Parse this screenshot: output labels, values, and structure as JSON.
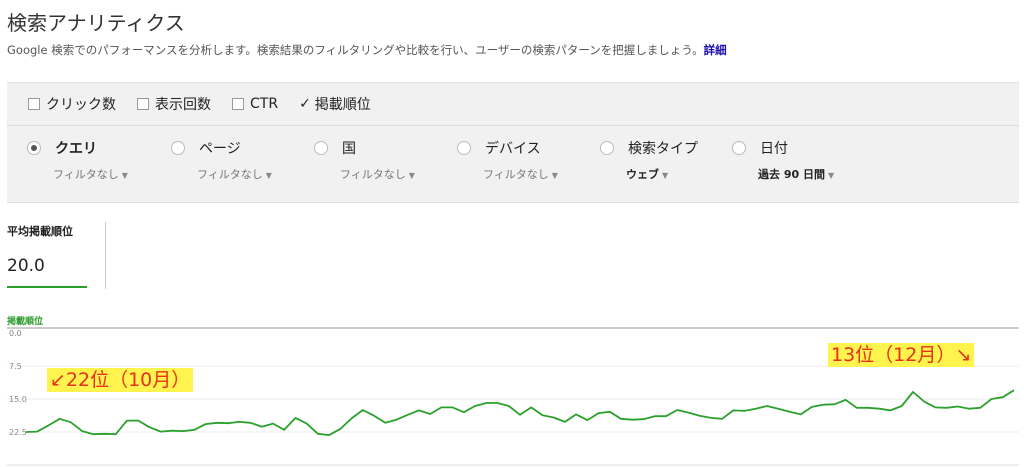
{
  "header": {
    "title": "検索アナリティクス",
    "description": "Google 検索でのパフォーマンスを分析します。検索結果のフィルタリングや比較を行い、ユーザーの検索パターンを把握しましょう。",
    "details_link": "詳細"
  },
  "metrics": [
    {
      "label": "クリック数",
      "checked": false
    },
    {
      "label": "表示回数",
      "checked": false
    },
    {
      "label": "CTR",
      "checked": false
    },
    {
      "label": "掲載順位",
      "checked": true,
      "mark": "✓"
    }
  ],
  "dimensions": [
    {
      "label": "クエリ",
      "selected": true,
      "filter": "フィルタなし"
    },
    {
      "label": "ページ",
      "selected": false,
      "filter": "フィルタなし"
    },
    {
      "label": "国",
      "selected": false,
      "filter": "フィルタなし"
    },
    {
      "label": "デバイス",
      "selected": false,
      "filter": "フィルタなし"
    },
    {
      "label": "検索タイプ",
      "selected": false,
      "filter": "ウェブ"
    },
    {
      "label": "日付",
      "selected": false,
      "filter": "過去 90 日間"
    }
  ],
  "summary": {
    "label": "平均掲載順位",
    "value": "20.0"
  },
  "annotations": {
    "start": "↙22位（10月）",
    "end": "13位（12月）↘"
  },
  "colors": {
    "series": "#2ca02c",
    "annotation_bg": "#fff34d",
    "annotation_text": "#e8311a"
  },
  "chart_data": {
    "type": "line",
    "title": "",
    "legend": "掲載順位",
    "y_ticks": [
      "0.0",
      "7.5",
      "15.0",
      "22.5"
    ],
    "ylim": [
      0,
      25
    ],
    "y_inverted": true,
    "series": [
      {
        "name": "掲載順位",
        "values": [
          22.5,
          22.4,
          21.0,
          19.5,
          20.3,
          22.3,
          23.0,
          22.9,
          23.0,
          19.9,
          19.9,
          21.4,
          22.4,
          22.2,
          22.3,
          22.0,
          20.7,
          20.4,
          20.5,
          20.2,
          20.4,
          21.3,
          20.6,
          22.0,
          19.3,
          20.6,
          22.9,
          23.2,
          21.8,
          19.4,
          17.5,
          18.8,
          20.4,
          19.7,
          18.6,
          17.6,
          18.4,
          16.9,
          16.9,
          18.0,
          16.6,
          15.9,
          15.9,
          16.6,
          18.6,
          16.9,
          18.7,
          19.2,
          20.2,
          18.5,
          19.8,
          18.2,
          17.9,
          19.5,
          19.7,
          19.6,
          18.9,
          18.9,
          17.5,
          18.1,
          18.8,
          19.3,
          19.5,
          17.6,
          17.7,
          17.2,
          16.6,
          17.2,
          17.9,
          18.5,
          16.8,
          16.3,
          16.2,
          15.2,
          17.0,
          17.0,
          17.2,
          17.6,
          16.6,
          13.4,
          15.6,
          16.9,
          17.0,
          16.7,
          17.2,
          17.0,
          15.0,
          14.6,
          13.0
        ]
      }
    ]
  }
}
